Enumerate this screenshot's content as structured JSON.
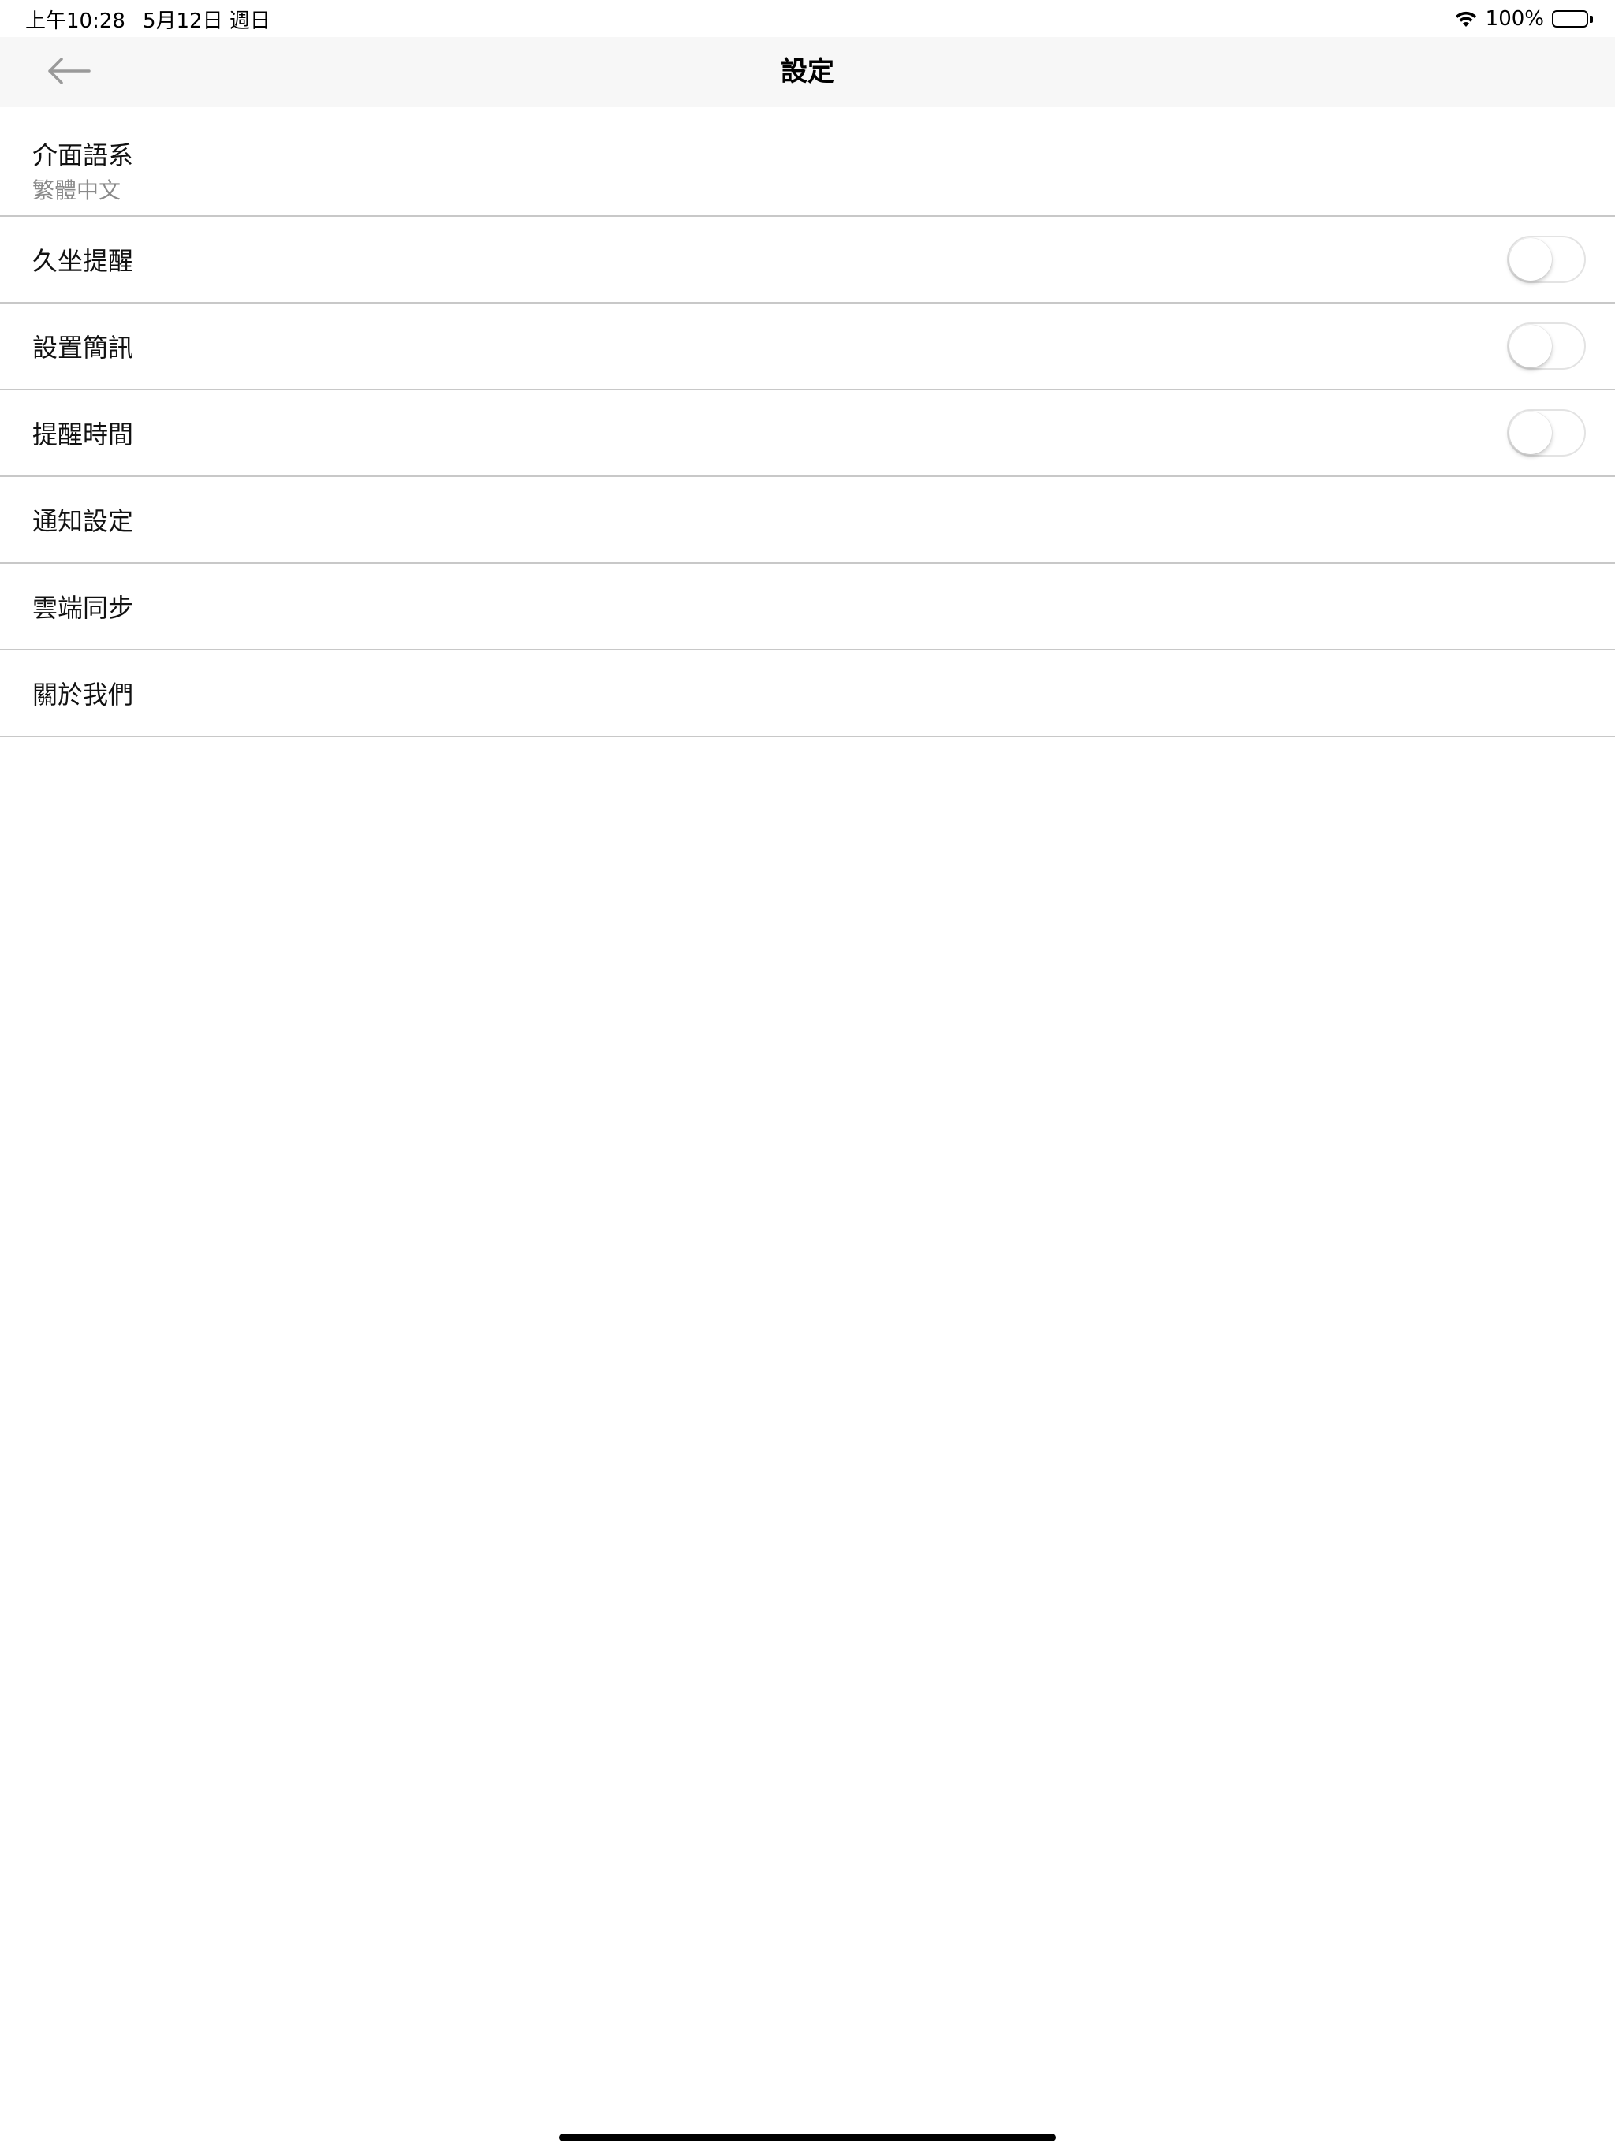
{
  "status_bar": {
    "time": "上午10:28",
    "date": "5月12日 週日",
    "battery_percent": "100%",
    "battery_level": 1.0,
    "wifi_icon": "wifi-icon",
    "battery_icon": "battery-icon"
  },
  "nav": {
    "title": "設定",
    "back_icon": "arrow-left-icon"
  },
  "settings": {
    "language": {
      "label": "介面語系",
      "value": "繁體中文"
    },
    "sedentary_reminder": {
      "label": "久坐提醒",
      "enabled": false
    },
    "sms_setting": {
      "label": "設置簡訊",
      "enabled": false
    },
    "reminder_time": {
      "label": "提醒時間",
      "enabled": false
    },
    "notification_settings": {
      "label": "通知設定"
    },
    "cloud_sync": {
      "label": "雲端同步"
    },
    "about_us": {
      "label": "關於我們"
    }
  },
  "colors": {
    "nav_background": "#f7f7f7",
    "separator": "#c8c8c8",
    "sublabel": "#8a8a8a",
    "back_arrow": "#9a9a9a",
    "toggle_off_border": "#e3e3e3"
  }
}
